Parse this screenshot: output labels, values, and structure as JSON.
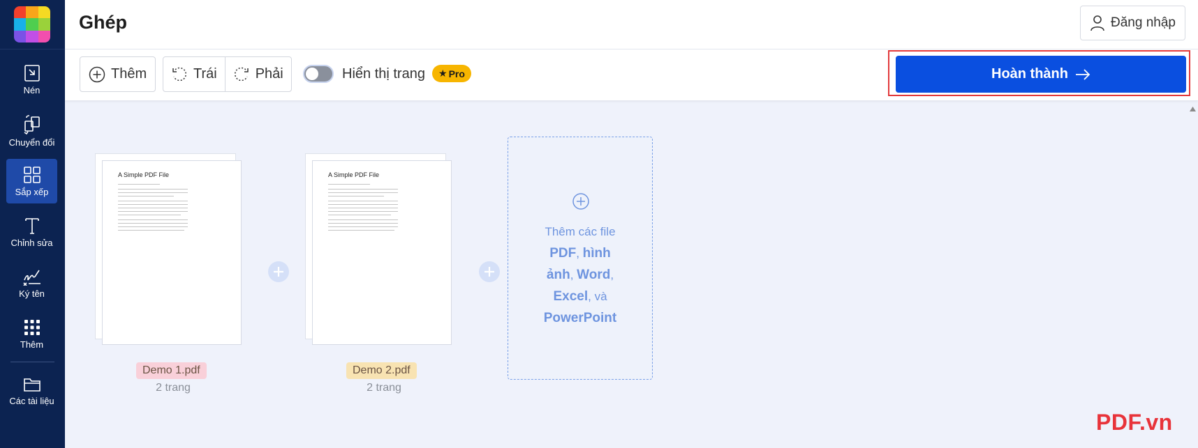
{
  "sidebar": {
    "logo_colors": [
      "#f3402c",
      "#f9a51a",
      "#f5da23",
      "#18b0e8",
      "#4fce4f",
      "#9ad23a",
      "#7a52e6",
      "#c14fe6",
      "#f24fae"
    ],
    "items": [
      {
        "label": "Nén",
        "icon": "compress-icon",
        "active": false
      },
      {
        "label": "Chuyển đổi",
        "icon": "convert-icon",
        "active": false
      },
      {
        "label": "Sắp xếp",
        "icon": "grid-icon",
        "active": true
      },
      {
        "label": "Chỉnh sửa",
        "icon": "text-icon",
        "active": false
      },
      {
        "label": "Ký tên",
        "icon": "signature-icon",
        "active": false
      },
      {
        "label": "Thêm",
        "icon": "more-apps-icon",
        "active": false
      },
      {
        "label": "Các tài liệu",
        "icon": "folder-icon",
        "active": false
      }
    ]
  },
  "header": {
    "title": "Ghép",
    "login_label": "Đăng nhập"
  },
  "toolbar": {
    "add_label": "Thêm",
    "rotate_left_label": "Trái",
    "rotate_right_label": "Phải",
    "show_pages_label": "Hiển thị trang",
    "show_pages_enabled": false,
    "pro_badge": "Pro",
    "finish_label": "Hoàn thành"
  },
  "files": [
    {
      "name": "Demo 1.pdf",
      "pages": "2 trang",
      "tag_color": "#f9d0d9",
      "preview_title": "A Simple PDF File"
    },
    {
      "name": "Demo 2.pdf",
      "pages": "2 trang",
      "tag_color": "#f8e3b2",
      "preview_title": "A Simple PDF File"
    }
  ],
  "dropzone": {
    "line1": "Thêm các file",
    "pdf": "PDF",
    "sep1": ", ",
    "images": "hình ảnh",
    "sep2": ", ",
    "word": "Word",
    "sep3": ",",
    "excel": "Excel",
    "and": ", và",
    "powerpoint": "PowerPoint"
  },
  "watermark": "PDF.vn",
  "colors": {
    "sidebar_bg": "#0c2351",
    "active_bg": "#1f4aa8",
    "accent": "#0a4fe0",
    "highlight_frame": "#e2393b"
  }
}
